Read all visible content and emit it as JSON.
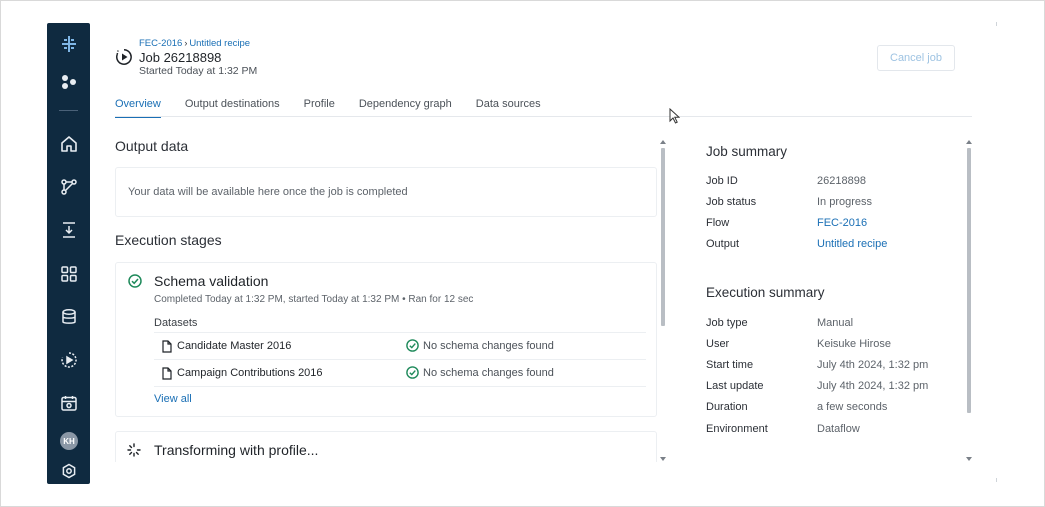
{
  "header": {
    "breadcrumb": [
      "FEC-2016",
      "Untitled recipe"
    ],
    "breadcrumb_sep": "›",
    "title": "Job 26218898",
    "started": "Started Today at 1:32 PM",
    "cancel_label": "Cancel job"
  },
  "sidebar": {
    "icons": [
      "logo-icon",
      "nodes-icon",
      "home-icon",
      "flows-icon",
      "job-icon",
      "library-icon",
      "database-icon",
      "run-icon",
      "calendar-icon",
      "settings-icon"
    ],
    "avatar": "KH",
    "active_color": "#0f2a40"
  },
  "tabs": [
    {
      "label": "Overview",
      "active": true
    },
    {
      "label": "Output destinations",
      "active": false
    },
    {
      "label": "Profile",
      "active": false
    },
    {
      "label": "Dependency graph",
      "active": false
    },
    {
      "label": "Data sources",
      "active": false
    }
  ],
  "output_data": {
    "title": "Output data",
    "message": "Your data will be available here once the job is completed"
  },
  "execution_stages": {
    "title": "Execution stages",
    "schema": {
      "title": "Schema validation",
      "subtitle": "Completed Today at 1:32 PM, started Today at 1:32 PM • Ran for 12 sec",
      "datasets_label": "Datasets",
      "datasets": [
        {
          "name": "Candidate Master 2016",
          "status": "No schema changes found"
        },
        {
          "name": "Campaign Contributions 2016",
          "status": "No schema changes found"
        }
      ],
      "view_all": "View all"
    },
    "transform": {
      "title": "Transforming with profile..."
    }
  },
  "job_summary": {
    "title": "Job summary",
    "rows": [
      {
        "label": "Job ID",
        "value": "26218898",
        "link": false
      },
      {
        "label": "Job status",
        "value": "In progress",
        "link": false
      },
      {
        "label": "Flow",
        "value": "FEC-2016",
        "link": true
      },
      {
        "label": "Output",
        "value": "Untitled recipe",
        "link": true
      }
    ]
  },
  "execution_summary": {
    "title": "Execution summary",
    "rows": [
      {
        "label": "Job type",
        "value": "Manual"
      },
      {
        "label": "User",
        "value": "Keisuke Hirose"
      },
      {
        "label": "Start time",
        "value": "July 4th 2024, 1:32 pm"
      },
      {
        "label": "Last update",
        "value": "July 4th 2024, 1:32 pm"
      },
      {
        "label": "Duration",
        "value": "a few seconds"
      },
      {
        "label": "Environment",
        "value": "Dataflow"
      }
    ]
  },
  "colors": {
    "accent": "#1a6fb5",
    "success": "#1f8a5b",
    "sidebar": "#0f2a40"
  }
}
